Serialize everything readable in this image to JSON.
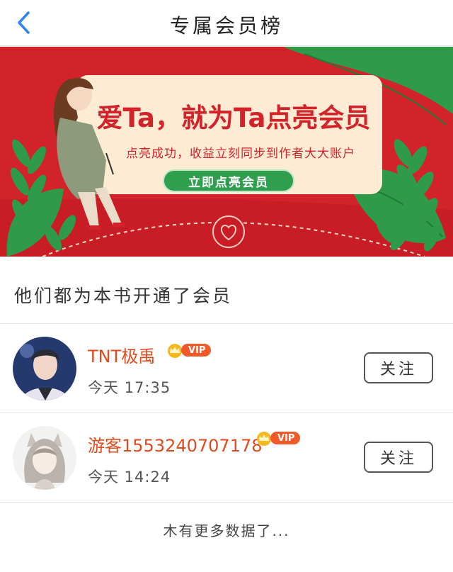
{
  "header": {
    "title": "专属会员榜",
    "back_icon": "chevron-left-icon"
  },
  "banner": {
    "headline": "爱Ta，就为Ta点亮会员",
    "subtitle": "点亮成功，收益立刻同步到作者大大账户",
    "button_label": "立即点亮会员",
    "colors": {
      "background": "#d2222a",
      "card": "#fdebd4",
      "button": "#2f9f4d",
      "leaf": "#2e9a4a"
    }
  },
  "section": {
    "title": "他们都为本书开通了会员"
  },
  "members": [
    {
      "name": "TNT极禹",
      "vip_label": "VIP",
      "time": "今天 17:35",
      "follow_label": "关注"
    },
    {
      "name": "游客1553240707178",
      "vip_label": "VIP",
      "time": "今天 14:24",
      "follow_label": "关注"
    }
  ],
  "footer": {
    "text": "木有更多数据了..."
  }
}
